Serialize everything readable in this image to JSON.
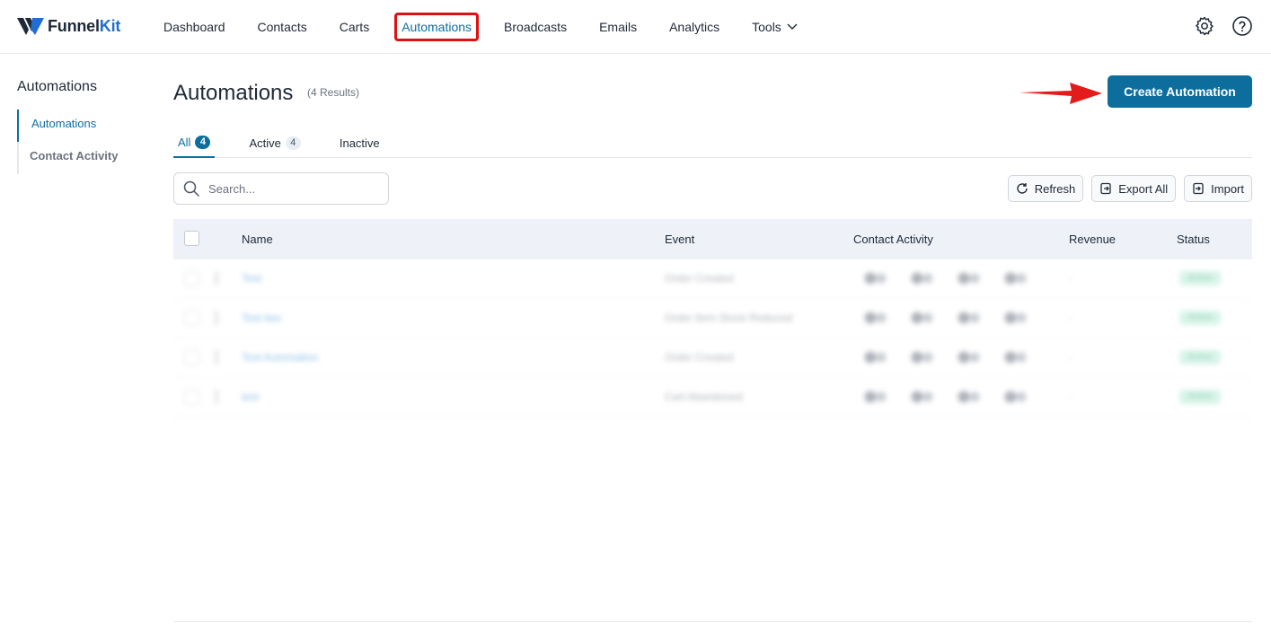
{
  "brand": {
    "name_part1": "Funnel",
    "name_part2": "Kit"
  },
  "nav": [
    {
      "label": "Dashboard"
    },
    {
      "label": "Contacts"
    },
    {
      "label": "Carts"
    },
    {
      "label": "Automations",
      "active": true
    },
    {
      "label": "Broadcasts"
    },
    {
      "label": "Emails"
    },
    {
      "label": "Analytics"
    },
    {
      "label": "Tools",
      "has_dropdown": true
    }
  ],
  "top_icons": [
    "gear-icon",
    "help-icon"
  ],
  "sidebar": {
    "title": "Automations",
    "items": [
      {
        "label": "Automations",
        "active": true
      },
      {
        "label": "Contact Activity"
      }
    ]
  },
  "page": {
    "title": "Automations",
    "results": "(4 Results)",
    "create_button": "Create Automation"
  },
  "tabs": [
    {
      "label": "All",
      "count": "4",
      "active": true
    },
    {
      "label": "Active",
      "count": "4"
    },
    {
      "label": "Inactive",
      "count": ""
    }
  ],
  "search": {
    "placeholder": "Search..."
  },
  "actions": [
    {
      "label": "Refresh",
      "icon": "refresh-icon"
    },
    {
      "label": "Export All",
      "icon": "export-icon"
    },
    {
      "label": "Import",
      "icon": "import-icon"
    }
  ],
  "table": {
    "headers": {
      "name": "Name",
      "event": "Event",
      "contact_activity": "Contact Activity",
      "revenue": "Revenue",
      "status": "Status"
    },
    "rows": [
      {
        "name": "Test",
        "event": "Order Created",
        "revenue": "-",
        "status": "Active"
      },
      {
        "name": "Test two",
        "event": "Order Item Stock Reduced",
        "revenue": "-",
        "status": "Active"
      },
      {
        "name": "Test Automation",
        "event": "Order Created",
        "revenue": "-",
        "status": "Active"
      },
      {
        "name": "test",
        "event": "Cart Abandoned",
        "revenue": "-",
        "status": "Active"
      }
    ]
  },
  "colors": {
    "primary": "#0d6e9e",
    "highlight": "#e01010",
    "arrow": "#e31b1b"
  }
}
